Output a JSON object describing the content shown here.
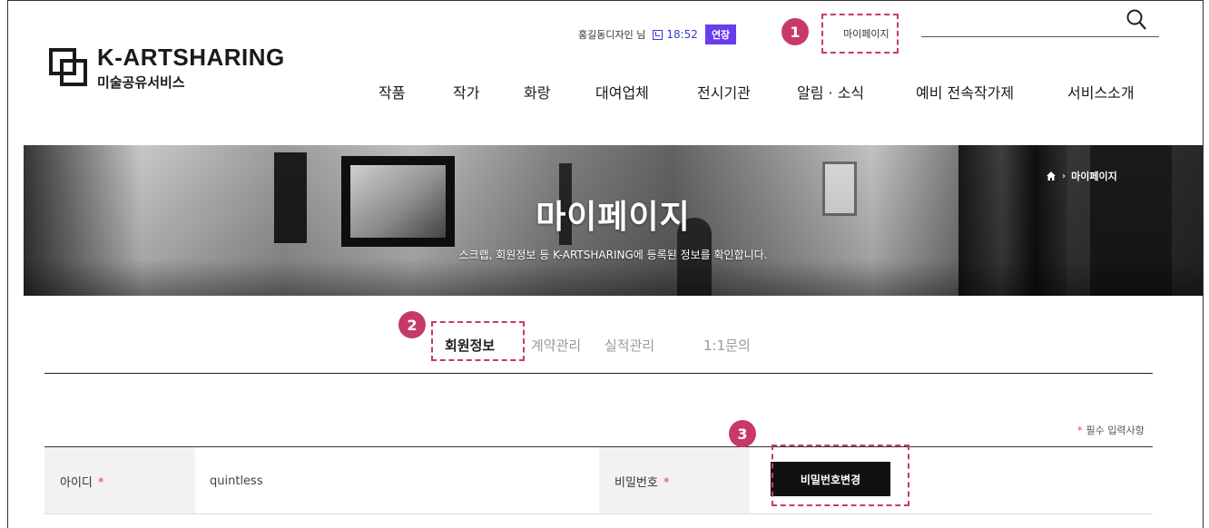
{
  "brand": {
    "name": "K-ARTSHARING",
    "subtitle": "미술공유서비스"
  },
  "utility": {
    "user_name": "홍길동디자인 님",
    "timer": "18:52",
    "extend_label": "연장",
    "mypage_link": "마이페이지"
  },
  "nav": {
    "items": [
      "작품",
      "작가",
      "화랑",
      "대여업체",
      "전시기관",
      "알림 · 소식",
      "예비 전속작가제",
      "서비스소개"
    ]
  },
  "banner": {
    "title": "마이페이지",
    "subtitle": "스크랩, 회원정보 등 K-ARTSHARING에 등록된 정보를 확인합니다.",
    "breadcrumb_current": "마이페이지",
    "breadcrumb_sep": "›"
  },
  "tabs": [
    {
      "label": "회원정보",
      "active": true
    },
    {
      "label": "계약관리",
      "active": false
    },
    {
      "label": "실적관리",
      "active": false
    },
    {
      "label": "1:1문의",
      "active": false
    }
  ],
  "form": {
    "required_note_star": "*",
    "required_note": "필수 입력사항",
    "id_label": "아이디",
    "id_value": "quintless",
    "pw_label": "비밀번호",
    "required_star": "*",
    "pw_change_button": "비밀번호변경"
  },
  "annotations": {
    "badge_1": "1",
    "badge_2": "2",
    "badge_3": "3"
  },
  "colors": {
    "accent_purple": "#6a3cf0",
    "tab_underline": "#9e86f3",
    "annotation": "#c8396b",
    "required": "#e0316b"
  }
}
